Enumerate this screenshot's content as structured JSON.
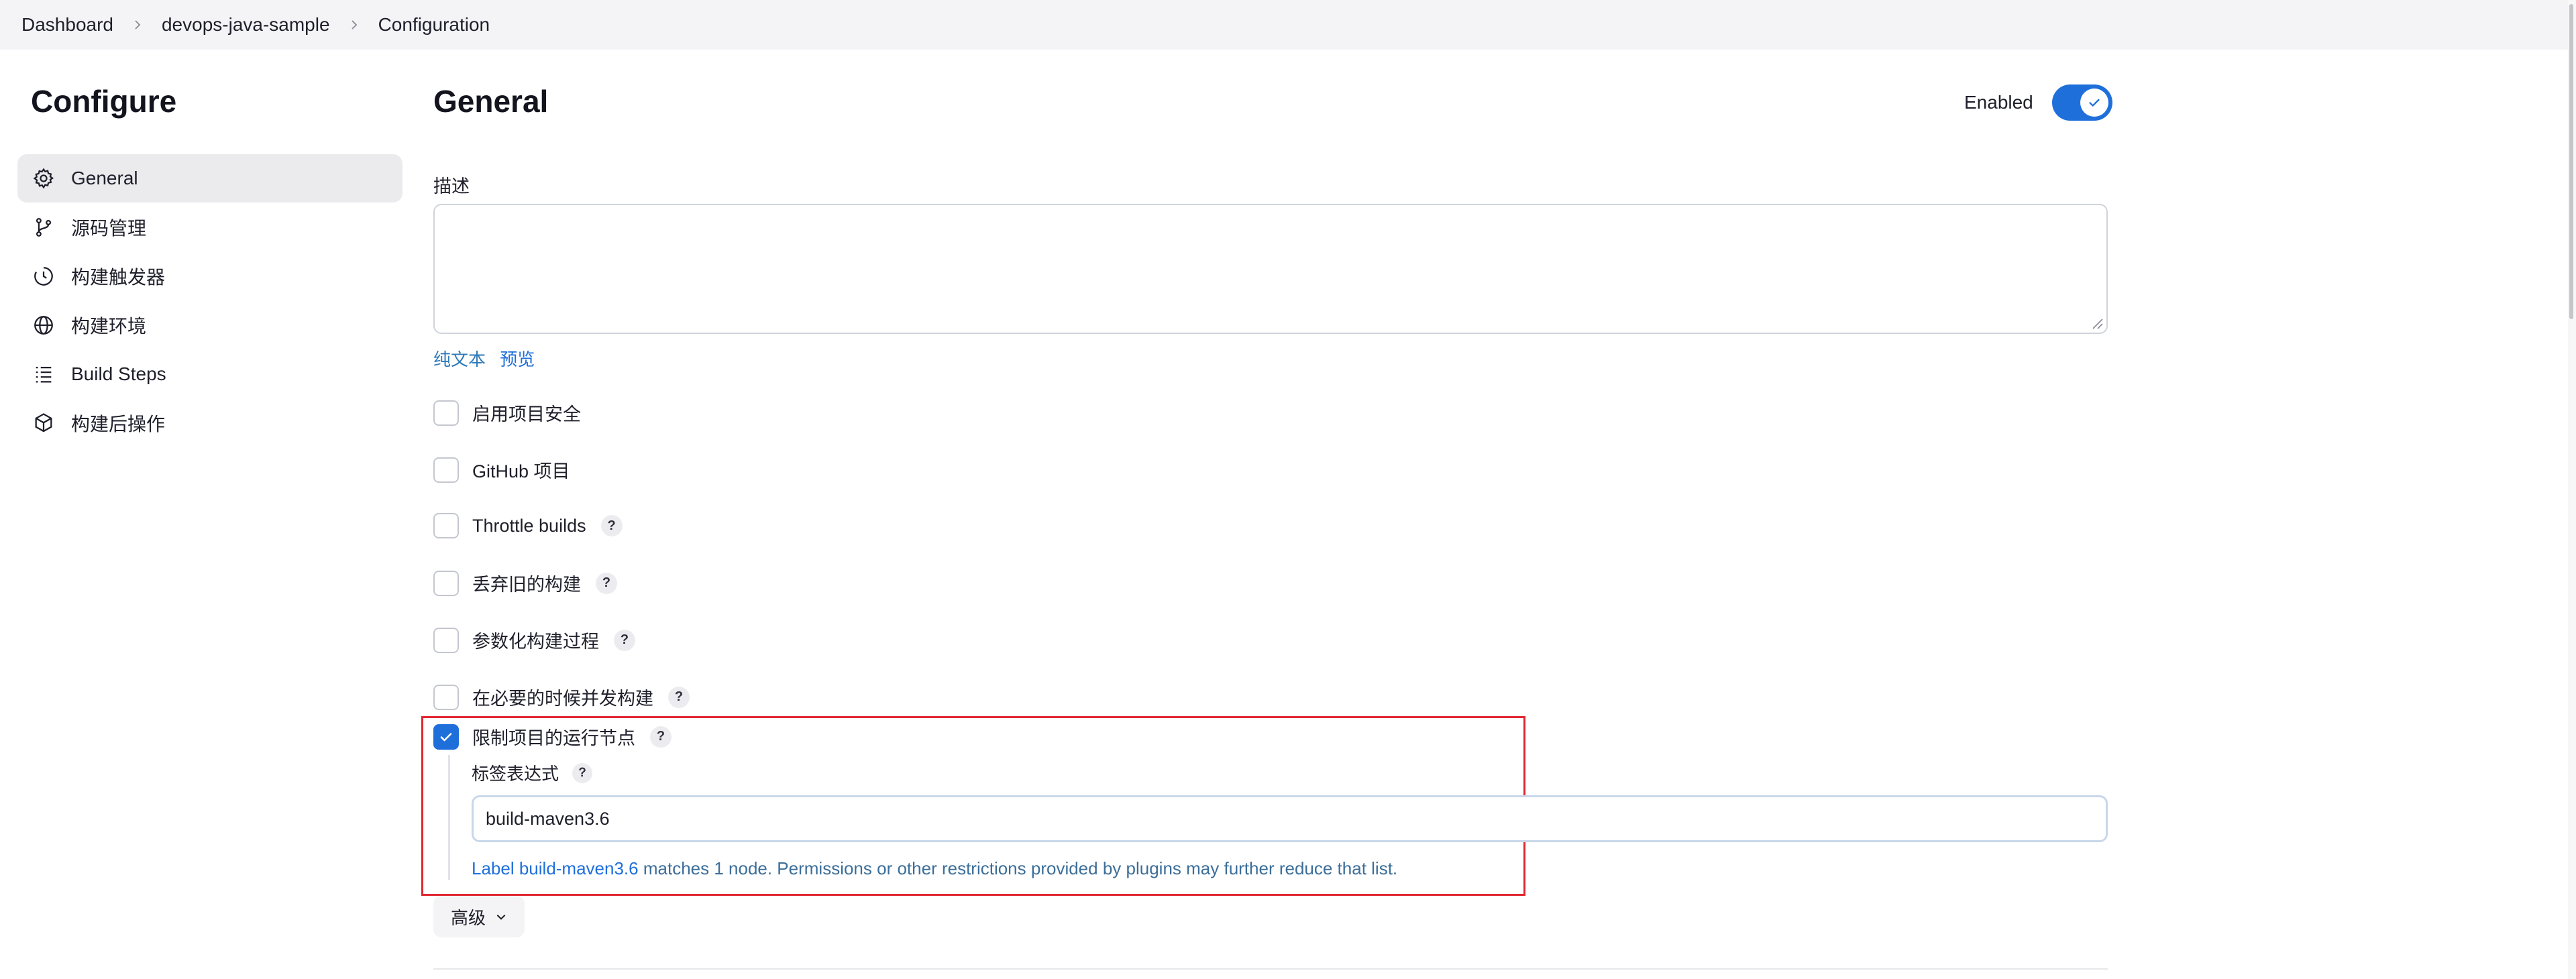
{
  "breadcrumb": {
    "items": [
      "Dashboard",
      "devops-java-sample",
      "Configuration"
    ]
  },
  "sidebar": {
    "title": "Configure",
    "items": [
      {
        "label": "General",
        "icon": "gear-icon",
        "active": true
      },
      {
        "label": "源码管理",
        "icon": "branch-icon",
        "active": false
      },
      {
        "label": "构建触发器",
        "icon": "timer-icon",
        "active": false
      },
      {
        "label": "构建环境",
        "icon": "globe-icon",
        "active": false
      },
      {
        "label": "Build Steps",
        "icon": "list-icon",
        "active": false
      },
      {
        "label": "构建后操作",
        "icon": "cube-icon",
        "active": false
      }
    ]
  },
  "main": {
    "title": "General",
    "enabled_label": "Enabled",
    "enabled": true,
    "description_label": "描述",
    "description_value": "",
    "format_links": [
      "纯文本",
      "预览"
    ],
    "options": [
      {
        "label": "启用项目安全",
        "checked": false,
        "help": false
      },
      {
        "label": "GitHub 项目",
        "checked": false,
        "help": false
      },
      {
        "label": "Throttle builds",
        "checked": false,
        "help": true
      },
      {
        "label": "丢弃旧的构建",
        "checked": false,
        "help": true
      },
      {
        "label": "参数化构建过程",
        "checked": false,
        "help": true
      },
      {
        "label": "在必要的时候并发构建",
        "checked": false,
        "help": true
      },
      {
        "label": "限制项目的运行节点",
        "checked": true,
        "help": true
      }
    ],
    "help_glyph": "?",
    "label_expression": {
      "label": "标签表达式",
      "value": "build-maven3.6",
      "match_link": "Label build-maven3.6",
      "match_text": " matches 1 node. Permissions or other restrictions provided by plugins may further reduce that list."
    },
    "advanced_label": "高级"
  },
  "colors": {
    "accent": "#1f6fdb",
    "highlight_box": "#e0262f",
    "breadcrumb_bg": "#f4f4f6"
  }
}
